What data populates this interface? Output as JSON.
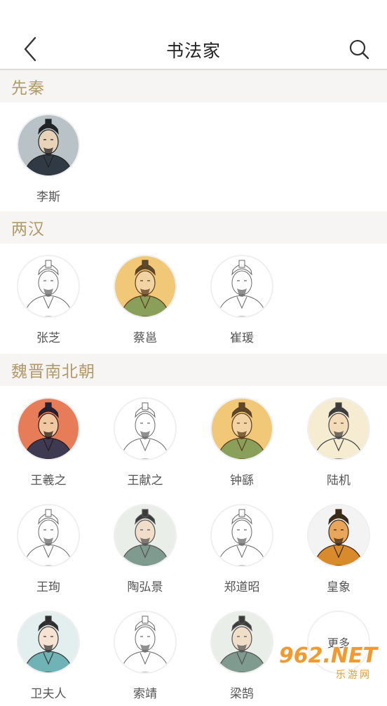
{
  "header": {
    "title": "书法家",
    "back_icon": "chevron-left-icon",
    "search_icon": "search-icon"
  },
  "sections": [
    {
      "title": "先秦",
      "people": [
        {
          "name": "李斯",
          "style": "gray"
        }
      ]
    },
    {
      "title": "两汉",
      "people": [
        {
          "name": "张芝",
          "style": "sketch"
        },
        {
          "name": "蔡邕",
          "style": "gold"
        },
        {
          "name": "崔瑗",
          "style": "sketch"
        }
      ]
    },
    {
      "title": "魏晋南北朝",
      "people": [
        {
          "name": "王羲之",
          "style": "red"
        },
        {
          "name": "王献之",
          "style": "sketch"
        },
        {
          "name": "钟繇",
          "style": "gold"
        },
        {
          "name": "陆机",
          "style": "cream"
        },
        {
          "name": "王珣",
          "style": "sketch"
        },
        {
          "name": "陶弘景",
          "style": "ink"
        },
        {
          "name": "郑道昭",
          "style": "sketch"
        },
        {
          "name": "皇象",
          "style": "orange"
        },
        {
          "name": "卫夫人",
          "style": "teal"
        },
        {
          "name": "索靖",
          "style": "sketch"
        },
        {
          "name": "梁鹄",
          "style": "ink"
        }
      ],
      "more_label": "更多"
    }
  ],
  "watermark": {
    "main": "962.NET",
    "sub": "乐游网"
  },
  "colors": {
    "accent": "#b09a6a",
    "section_bg": "#f6f5f3",
    "watermark": "#f29a2e"
  }
}
